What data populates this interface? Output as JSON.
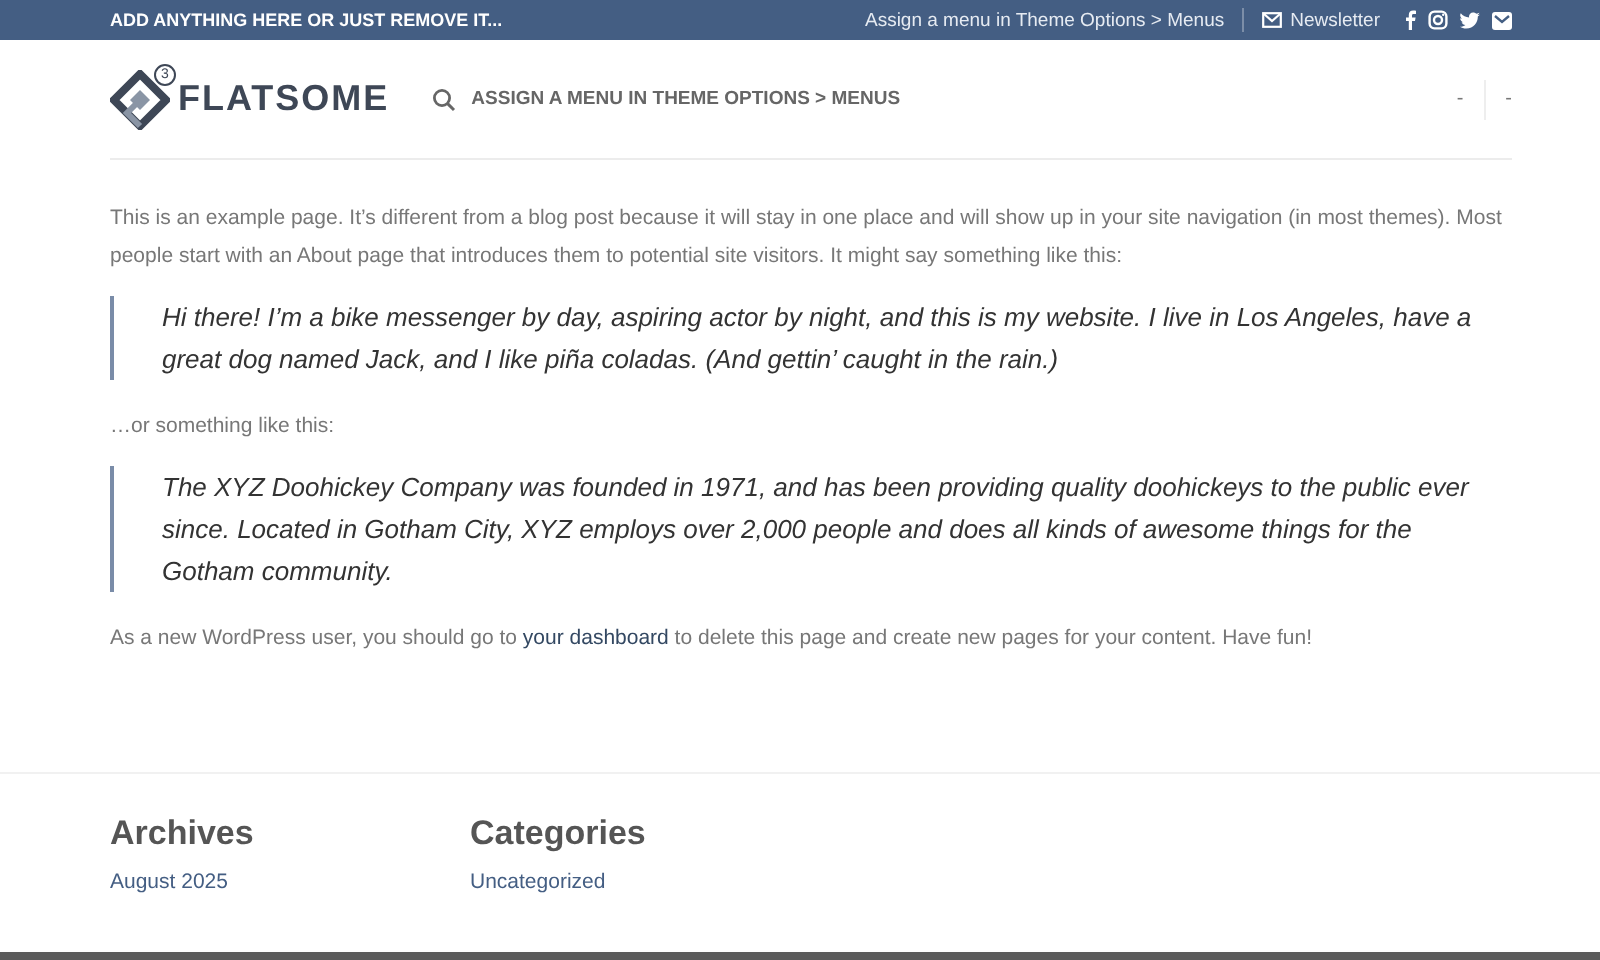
{
  "top_bar": {
    "promo": "ADD ANYTHING HERE OR JUST REMOVE IT...",
    "menu_hint": "Assign a menu in Theme Options > Menus",
    "newsletter": "Newsletter"
  },
  "header": {
    "logo_badge": "3",
    "logo_text": "FLATSOME",
    "nav_hint": "ASSIGN A MENU IN THEME OPTIONS > MENUS",
    "right_items": [
      "-",
      "-"
    ]
  },
  "content": {
    "intro": "This is an example page. It’s different from a blog post because it will stay in one place and will show up in your site navigation (in most themes). Most people start with an About page that introduces them to potential site visitors. It might say something like this:",
    "quote_1": "Hi there! I’m a bike messenger by day, aspiring actor by night, and this is my website. I live in Los Angeles, have a great dog named Jack, and I like piña coladas. (And gettin’ caught in the rain.)",
    "middle": "…or something like this:",
    "quote_2": "The XYZ Doohickey Company was founded in 1971, and has been providing quality doohickeys to the public ever since. Located in Gotham City, XYZ employs over 2,000 people and does all kinds of awesome things for the Gotham community.",
    "outro_before": "As a new WordPress user, you should go to ",
    "outro_link": "your dashboard",
    "outro_after": " to delete this page and create new pages for your content. Have fun!"
  },
  "footer_widgets": [
    {
      "title": "Archives",
      "links": [
        "August 2025"
      ]
    },
    {
      "title": "Categories",
      "links": [
        "Uncategorized"
      ]
    }
  ]
}
